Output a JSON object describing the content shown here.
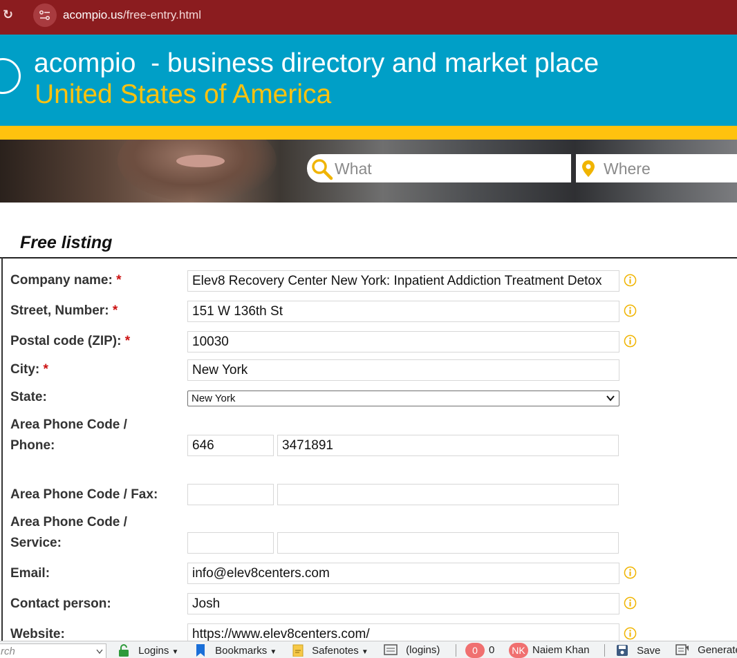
{
  "browser": {
    "url_host": "acompio.us",
    "url_path": "/free-entry.html"
  },
  "header": {
    "title": "acompio  - business directory and market place",
    "country": "United States of America"
  },
  "search": {
    "what_placeholder": "What",
    "where_placeholder": "Where"
  },
  "form": {
    "title": "Free listing",
    "company_label": "Company name:",
    "street_label": "Street, Number:",
    "postal_label": "Postal code (ZIP):",
    "city_label": "City:",
    "state_label": "State:",
    "phone_label_1": "Area Phone Code /",
    "phone_label_2": "Phone:",
    "fax_label": "Area Phone Code / Fax:",
    "service_label_1": "Area Phone Code /",
    "service_label_2": "Service:",
    "email_label": "Email:",
    "contact_label": "Contact person:",
    "website_label": "Website:",
    "required_mark": "*",
    "company_value": "Elev8 Recovery Center New York: Inpatient Addiction Treatment Detox",
    "street_value": "151 W 136th St",
    "postal_value": "10030",
    "city_value": "New York",
    "state_value": "New York",
    "phone_area_value": "646",
    "phone_value": "3471891",
    "fax_area_value": "",
    "fax_value": "",
    "service_area_value": "",
    "service_value": "",
    "email_value": "info@elev8centers.com",
    "contact_value": "Josh",
    "website_value": "https://www.elev8centers.com/"
  },
  "bottombar": {
    "search_text": "rch",
    "logins": "Logins",
    "bookmarks": "Bookmarks",
    "safenotes": "Safenotes",
    "logins_paren": "(logins)",
    "count_badge": "0",
    "count": "0",
    "user_initials": "NK",
    "user_name": "Naiem Khan",
    "save": "Save",
    "generate": "Generate"
  },
  "colors": {
    "chrome": "#8b1c1f",
    "banner": "#009fc7",
    "accent_yellow": "#ffc20e",
    "info_icon": "#f0b400"
  }
}
